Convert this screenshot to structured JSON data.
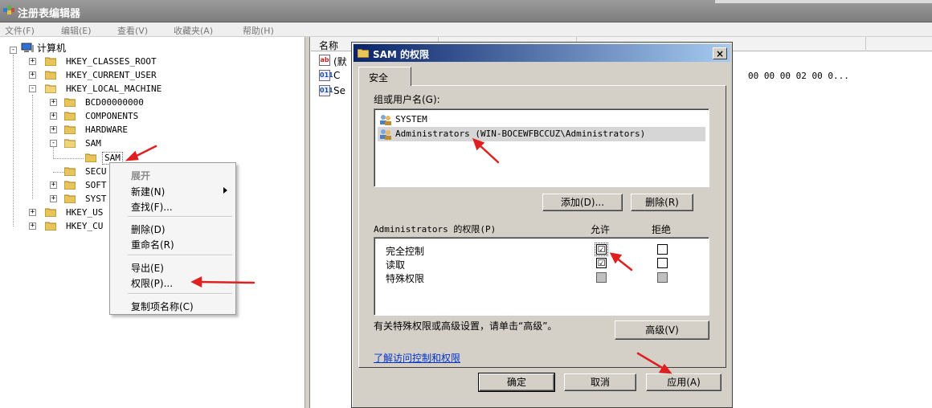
{
  "window": {
    "title": "注册表编辑器"
  },
  "menu": [
    "文件(F)",
    "编辑(E)",
    "查看(V)",
    "收藏夹(A)",
    "帮助(H)"
  ],
  "tree": {
    "root": "计算机",
    "nodes": [
      "HKEY_CLASSES_ROOT",
      "HKEY_CURRENT_USER",
      "HKEY_LOCAL_MACHINE",
      "BCD00000000",
      "COMPONENTS",
      "HARDWARE",
      "SAM",
      "SAM",
      "SECU",
      "SOFT",
      "SYST",
      "HKEY_US",
      "HKEY_CU"
    ]
  },
  "list": {
    "header_name": "名称",
    "rows": [
      "(默",
      "C",
      "Se"
    ],
    "value_fragment": "00 00 00 02 00 0..."
  },
  "context_menu": {
    "expand": "展开",
    "new": "新建(N)",
    "find": "查找(F)...",
    "delete": "删除(D)",
    "rename": "重命名(R)",
    "export": "导出(E)",
    "permissions": "权限(P)...",
    "copy_key_name": "复制项名称(C)"
  },
  "dialog": {
    "title": "SAM 的权限",
    "close": "×",
    "tab": "安全",
    "groups_label": "组或用户名(G):",
    "users": [
      "SYSTEM",
      "Administrators (WIN-BOCEWFBCCUZ\\Administrators)"
    ],
    "add_button": "添加(D)...",
    "remove_button": "删除(R)",
    "perm_label": "Administrators 的权限(P)",
    "allow_header": "允许",
    "deny_header": "拒绝",
    "permissions": [
      {
        "name": "完全控制",
        "allow": "☑",
        "deny": ""
      },
      {
        "name": "读取",
        "allow": "☑",
        "deny": ""
      },
      {
        "name": "特殊权限",
        "allow": "",
        "deny": ""
      }
    ],
    "advanced_note": "有关特殊权限或高级设置，请单击“高级”。",
    "advanced_button": "高级(V)",
    "learn_link": "了解访问控制和权限",
    "ok_button": "确定",
    "cancel_button": "取消",
    "apply_button": "应用(A)"
  },
  "colors": {
    "annotation_arrow": "#e02020",
    "dialog_title_start": "#0a246a",
    "dialog_title_end": "#a6caf0",
    "dialog_face": "#d4d0c8",
    "link": "#0033cc"
  }
}
